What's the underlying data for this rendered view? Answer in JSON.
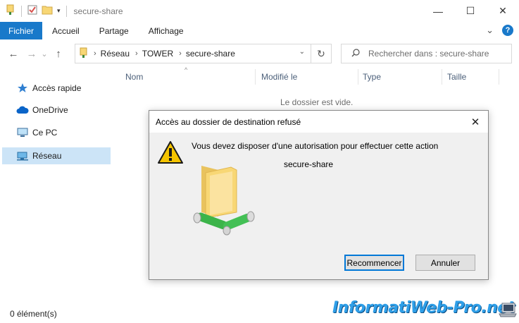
{
  "window": {
    "title": "secure-share",
    "minimize_glyph": "—",
    "maximize_glyph": "☐",
    "close_glyph": "✕"
  },
  "ribbon": {
    "tabs": [
      {
        "label": "Fichier"
      },
      {
        "label": "Accueil"
      },
      {
        "label": "Partage"
      },
      {
        "label": "Affichage"
      }
    ],
    "expand_glyph": "⌄",
    "help_glyph": "?"
  },
  "nav": {
    "back_glyph": "←",
    "forward_glyph": "→",
    "recent_glyph": "⌄",
    "up_glyph": "↑",
    "breadcrumbs": [
      "Réseau",
      "TOWER",
      "secure-share"
    ],
    "crumb_sep": "›",
    "dropdown_glyph": "⌄",
    "refresh_glyph": "↻",
    "search_placeholder": "Rechercher dans : secure-share"
  },
  "sidebar": {
    "items": [
      {
        "label": "Accès rapide",
        "icon": "star-icon",
        "selected": false
      },
      {
        "label": "OneDrive",
        "icon": "cloud-icon",
        "selected": false
      },
      {
        "label": "Ce PC",
        "icon": "computer-icon",
        "selected": false
      },
      {
        "label": "Réseau",
        "icon": "network-icon",
        "selected": true
      }
    ]
  },
  "columns": {
    "name": "Nom",
    "modified": "Modifié le",
    "type": "Type",
    "size": "Taille",
    "sort_glyph": "^"
  },
  "content": {
    "empty_message": "Le dossier est vide."
  },
  "status": {
    "item_count": "0 élément(s)"
  },
  "dialog": {
    "title": "Accès au dossier de destination refusé",
    "close_glyph": "✕",
    "message": "Vous devez disposer d'une autorisation pour effectuer cette action",
    "share_name": "secure-share",
    "retry_label": "Recommencer",
    "cancel_label": "Annuler"
  },
  "watermark": {
    "text": "InformatiWeb-Pro.net"
  },
  "colors": {
    "accent": "#1979ca",
    "selection": "#cce4f7",
    "focus_border": "#0078d7",
    "warning": "#f5c400",
    "folder": "#f8d775",
    "network_pipe": "#3cb44a"
  }
}
